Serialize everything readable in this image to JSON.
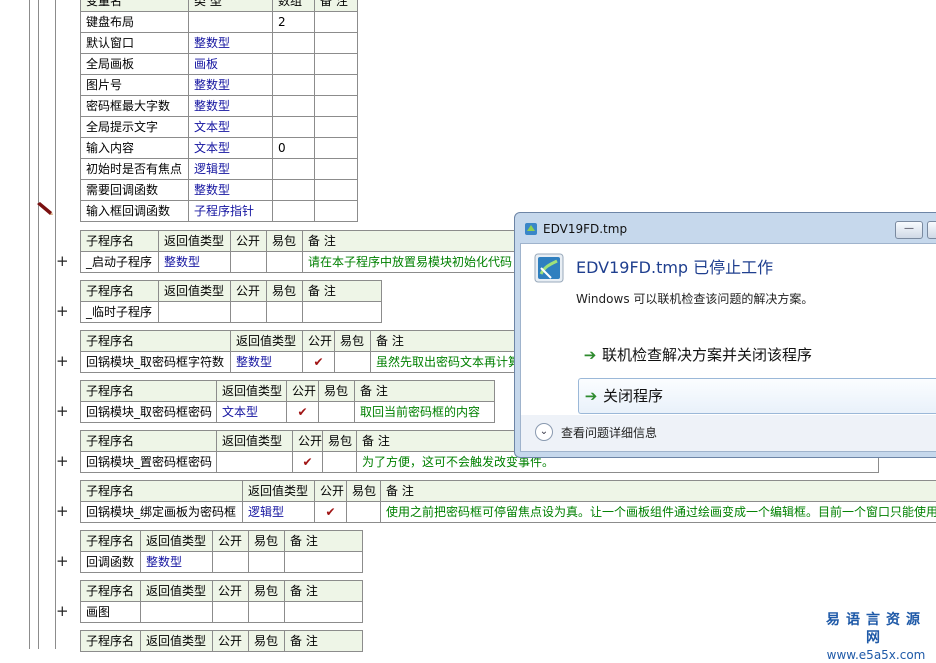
{
  "var_table": {
    "headers": [
      "变量名",
      "类 型",
      "数组",
      "备 注"
    ],
    "rows": [
      [
        "键盘布局",
        "",
        "2",
        ""
      ],
      [
        "默认窗口",
        "整数型",
        "",
        ""
      ],
      [
        "全局画板",
        "画板",
        "",
        ""
      ],
      [
        "图片号",
        "整数型",
        "",
        ""
      ],
      [
        "密码框最大字数",
        "整数型",
        "",
        ""
      ],
      [
        "全局提示文字",
        "文本型",
        "",
        ""
      ],
      [
        "输入内容",
        "文本型",
        "0",
        ""
      ],
      [
        "初始时是否有焦点",
        "逻辑型",
        "",
        ""
      ],
      [
        "需要回调函数",
        "整数型",
        "",
        ""
      ],
      [
        "输入框回调函数",
        "子程序指针",
        "",
        ""
      ]
    ]
  },
  "sub_header": {
    "name": "子程序名",
    "ret": "返回值类型",
    "pub": "公开",
    "pkg": "易包",
    "note": "备 注"
  },
  "subs": [
    {
      "name": "_启动子程序",
      "ret": "整数型",
      "pub": "",
      "note": "请在本子程序中放置易模块初始化代码"
    },
    {
      "name": "_临时子程序",
      "ret": "",
      "pub": "",
      "note": ""
    },
    {
      "name": "回锅模块_取密码框字符数",
      "ret": "整数型",
      "pub": "✔",
      "note": "虽然先取出密码文本再计算"
    },
    {
      "name": "回锅模块_取密码框密码",
      "ret": "文本型",
      "pub": "✔",
      "note": "取回当前密码框的内容"
    },
    {
      "name": "回锅模块_置密码框密码",
      "ret": "",
      "pub": "✔",
      "note": "为了方便，这可不会触发改变事件。"
    },
    {
      "name": "回锅模块_绑定画板为密码框",
      "ret": "逻辑型",
      "pub": "✔",
      "note": "使用之前把密码框可停留焦点设为真。让一个画板组件通过绘画变成一个编辑框。目前一个窗口只能使用"
    },
    {
      "name": "回调函数",
      "ret": "整数型",
      "pub": "",
      "note": ""
    },
    {
      "name": "画图",
      "ret": "",
      "pub": "",
      "note": ""
    },
    {
      "name": "",
      "ret": "",
      "pub": "",
      "note": ""
    }
  ],
  "expand_symbol": "+",
  "dialog": {
    "title": "EDV19FD.tmp",
    "heading": "EDV19FD.tmp 已停止工作",
    "subtext": "Windows 可以联机检查该问题的解决方案。",
    "option1": "联机检查解决方案并关闭该程序",
    "option2": "关闭程序",
    "details": "查看问题详细信息",
    "arrow": "➔",
    "chevron": "⌄",
    "minimize_glyph": "—"
  },
  "watermark": {
    "line1": "易语言资源网",
    "line2": "www.e5a5x.com"
  },
  "colors": {
    "header_bg": "#eef5e7",
    "type_blue": "#1414a0",
    "note_green": "#008000",
    "dialog_frame": "#c6d8ec"
  }
}
